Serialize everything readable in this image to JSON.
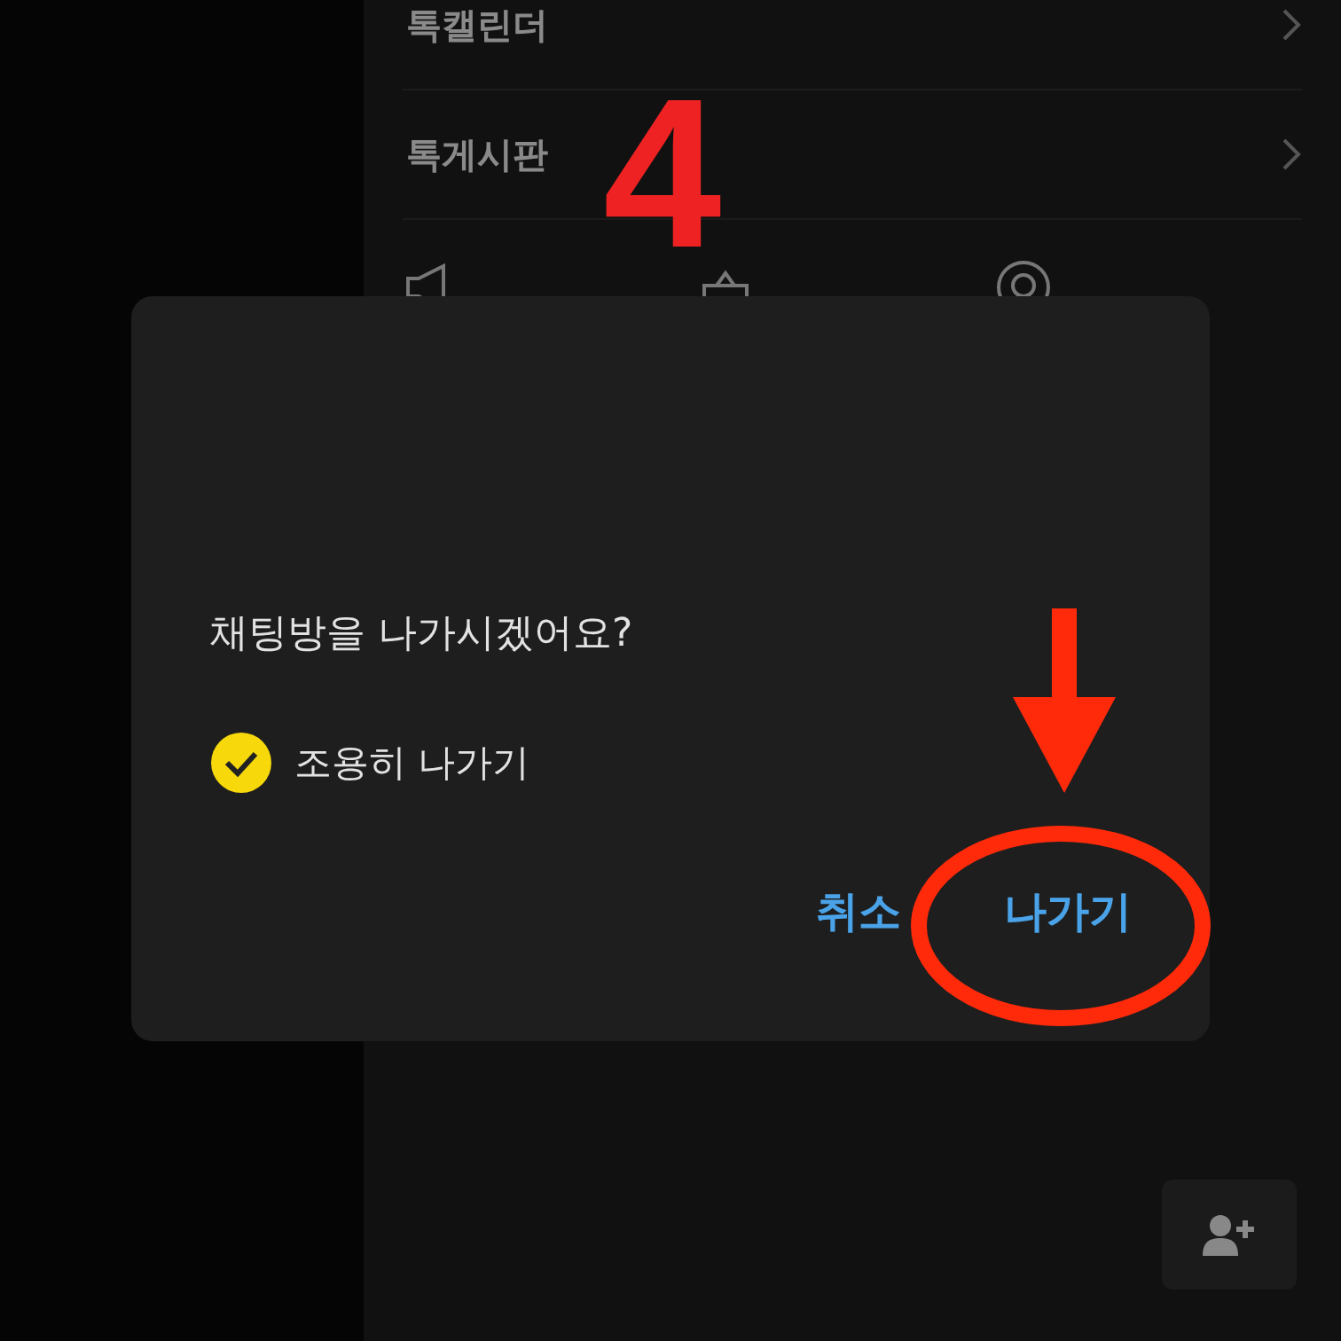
{
  "menu": {
    "rows": [
      {
        "label": "톡캘린더"
      },
      {
        "label": "톡게시판"
      }
    ],
    "shortcuts": [
      {
        "kind": "megaphone"
      },
      {
        "kind": "ballot"
      },
      {
        "kind": "quiz"
      }
    ]
  },
  "dialog": {
    "title": "채팅방을 나가시겠어요?",
    "option": {
      "label": "조용히 나가기",
      "checked": true
    },
    "buttons": [
      {
        "label": "취소"
      },
      {
        "label": "나가기"
      }
    ]
  },
  "annotation": {
    "step": "4"
  }
}
